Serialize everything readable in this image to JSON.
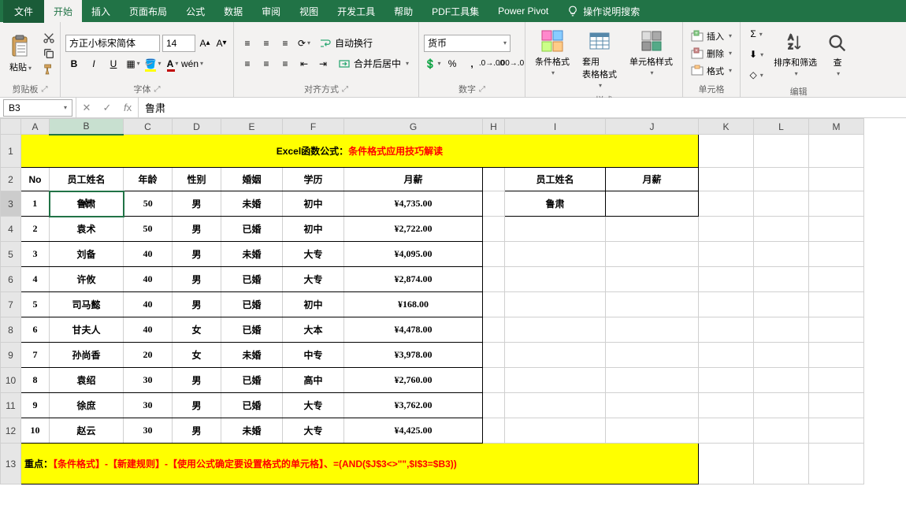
{
  "tabs": {
    "file": "文件",
    "list": [
      "开始",
      "插入",
      "页面布局",
      "公式",
      "数据",
      "审阅",
      "视图",
      "开发工具",
      "帮助",
      "PDF工具集",
      "Power Pivot"
    ],
    "tell_me": "操作说明搜索"
  },
  "ribbon": {
    "clipboard": {
      "paste": "粘贴",
      "label": "剪贴板"
    },
    "font": {
      "name": "方正小标宋简体",
      "size": "14",
      "label": "字体"
    },
    "alignment": {
      "wrap": "自动换行",
      "merge": "合并后居中",
      "label": "对齐方式"
    },
    "number": {
      "format": "货币",
      "label": "数字"
    },
    "styles": {
      "conditional": "条件格式",
      "table": "套用\n表格格式",
      "cell": "单元格样式",
      "label": "样式"
    },
    "cells": {
      "insert": "插入",
      "delete": "删除",
      "format": "格式",
      "label": "单元格"
    },
    "editing": {
      "sort": "排序和筛选",
      "find": "查",
      "label": "编辑"
    }
  },
  "formula_bar": {
    "name_box": "B3",
    "formula": "鲁肃"
  },
  "columns": [
    "A",
    "B",
    "C",
    "D",
    "E",
    "F",
    "G",
    "H",
    "I",
    "J",
    "K",
    "L",
    "M"
  ],
  "sheet": {
    "title_black": "Excel函数公式：",
    "title_red": "条件格式应用技巧解读",
    "headers": [
      "No",
      "员工姓名",
      "年龄",
      "性别",
      "婚姻",
      "学历",
      "月薪"
    ],
    "side_headers": [
      "员工姓名",
      "月薪"
    ],
    "side_value": "鲁肃",
    "rows": [
      {
        "no": "1",
        "name": "鲁肃",
        "age": "50",
        "sex": "男",
        "marry": "未婚",
        "edu": "初中",
        "salary": "¥4,735.00"
      },
      {
        "no": "2",
        "name": "袁术",
        "age": "50",
        "sex": "男",
        "marry": "已婚",
        "edu": "初中",
        "salary": "¥2,722.00"
      },
      {
        "no": "3",
        "name": "刘备",
        "age": "40",
        "sex": "男",
        "marry": "未婚",
        "edu": "大专",
        "salary": "¥4,095.00"
      },
      {
        "no": "4",
        "name": "许攸",
        "age": "40",
        "sex": "男",
        "marry": "已婚",
        "edu": "大专",
        "salary": "¥2,874.00"
      },
      {
        "no": "5",
        "name": "司马懿",
        "age": "40",
        "sex": "男",
        "marry": "已婚",
        "edu": "初中",
        "salary": "¥168.00"
      },
      {
        "no": "6",
        "name": "甘夫人",
        "age": "40",
        "sex": "女",
        "marry": "已婚",
        "edu": "大本",
        "salary": "¥4,478.00"
      },
      {
        "no": "7",
        "name": "孙尚香",
        "age": "20",
        "sex": "女",
        "marry": "未婚",
        "edu": "中专",
        "salary": "¥3,978.00"
      },
      {
        "no": "8",
        "name": "袁绍",
        "age": "30",
        "sex": "男",
        "marry": "已婚",
        "edu": "高中",
        "salary": "¥2,760.00"
      },
      {
        "no": "9",
        "name": "徐庶",
        "age": "30",
        "sex": "男",
        "marry": "已婚",
        "edu": "大专",
        "salary": "¥3,762.00"
      },
      {
        "no": "10",
        "name": "赵云",
        "age": "30",
        "sex": "男",
        "marry": "未婚",
        "edu": "大专",
        "salary": "¥4,425.00"
      }
    ],
    "note_black": "重点：",
    "note_red": "【条件格式】-【新建规则】-【使用公式确定要设置格式的单元格】、=(AND($J$3<>\"\",$I$3=$B3))"
  }
}
